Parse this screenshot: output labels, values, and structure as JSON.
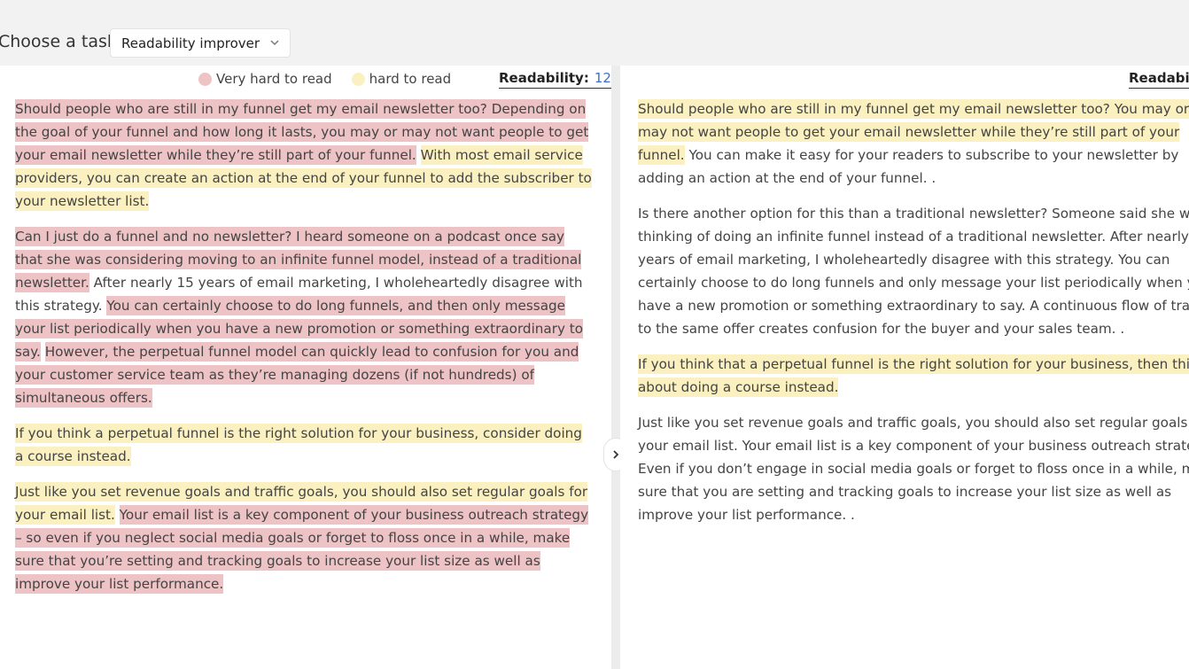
{
  "header": {
    "task_label": "Choose a task",
    "task_selected": "Readability improver"
  },
  "colors": {
    "very_hard": "#eec3c5",
    "hard": "#fbf0bf",
    "score": "#3b6fd1"
  },
  "legend": {
    "very_hard": "Very hard to read",
    "hard": "hard to read"
  },
  "left": {
    "readability_label": "Readability:",
    "readability_score": "12",
    "paragraphs": [
      [
        {
          "text": "Should people who are still in my funnel get my email newsletter too? Depending on the goal of your funnel and how long it lasts, you may or may not want people to get your email newsletter while they’re still part of your funnel.",
          "hl": "red"
        },
        {
          "text": " ",
          "hl": "none"
        },
        {
          "text": "With most email service providers, you can create an action at the end of your funnel to add the subscriber to your newsletter list.",
          "hl": "yellow"
        }
      ],
      [
        {
          "text": "Can I just do a funnel and no newsletter? I heard someone on a podcast once say that she was considering moving to an infinite funnel model, instead of a traditional newsletter.",
          "hl": "red"
        },
        {
          "text": " After nearly 15 years of email marketing, I wholeheartedly disagree with this strategy. ",
          "hl": "none"
        },
        {
          "text": "You can certainly choose to do long funnels, and then only message your list periodically when you have a new promotion or something extraordinary to say.",
          "hl": "red"
        },
        {
          "text": " ",
          "hl": "none"
        },
        {
          "text": "However, the perpetual funnel model can quickly lead to confusion for you and your customer service team as they’re managing dozens (if not hundreds) of simultaneous offers.",
          "hl": "red"
        }
      ],
      [
        {
          "text": "If you think a perpetual funnel is the right solution for your business, consider doing a course instead.",
          "hl": "yellow"
        }
      ],
      [
        {
          "text": "Just like you set revenue goals and traffic goals, you should also set regular goals for your email list.",
          "hl": "yellow"
        },
        {
          "text": " ",
          "hl": "none"
        },
        {
          "text": "Your email list is a key component of your business outreach strategy – so even if you neglect social media goals or forget to floss once in a while, make sure that you’re setting and tracking goals to increase your list size as well as improve your list performance.",
          "hl": "red"
        }
      ]
    ]
  },
  "right": {
    "readability_label": "Readability:",
    "paragraphs": [
      [
        {
          "text": "Should people who are still in my funnel get my email newsletter too? You may or may not want people to get your email newsletter while they’re still part of your funnel.",
          "hl": "yellow"
        },
        {
          "text": " You can make it easy for your readers to subscribe to your newsletter by adding an action at the end of your funnel. .",
          "hl": "none"
        }
      ],
      [
        {
          "text": "Is there another option for this than a traditional newsletter? Someone said she was thinking of doing an infinite funnel instead of a traditional newsletter. After nearly 15 years of email marketing, I wholeheartedly disagree with this strategy. You can certainly choose to do long funnels and only message your list periodically when you have a new promotion or something extraordinary to say. A continuous flow of traffic to the same offer creates confusion for the buyer and your sales team. .",
          "hl": "none"
        }
      ],
      [
        {
          "text": "If you think that a perpetual funnel is the right solution for your business, then think about doing a course instead.",
          "hl": "yellow"
        }
      ],
      [
        {
          "text": "Just like you set revenue goals and traffic goals, you should also set regular goals for your email list. Your email list is a key component of your business outreach strategy. Even if you don’t engage in social media goals or forget to floss once in a while, make sure that you are setting and tracking goals to increase your list size as well as improve your list performance. .",
          "hl": "none"
        }
      ]
    ]
  }
}
